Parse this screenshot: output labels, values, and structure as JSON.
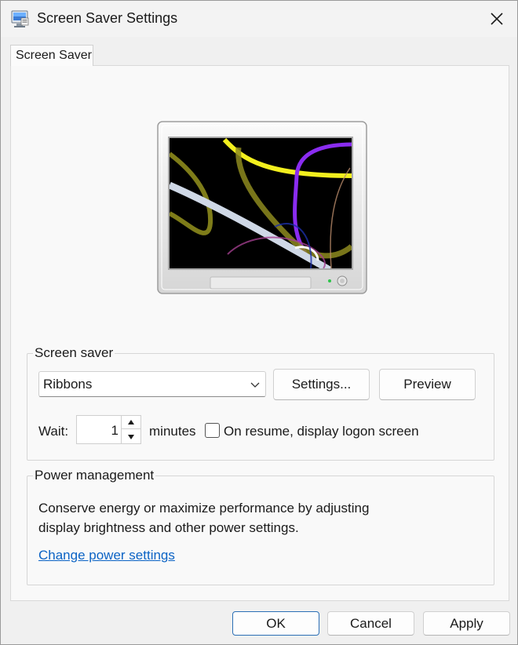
{
  "window": {
    "title": "Screen Saver Settings",
    "icon": "display-settings-icon"
  },
  "tabs": [
    {
      "label": "Screen Saver",
      "selected": true
    }
  ],
  "preview": {
    "screensaver_name": "Ribbons"
  },
  "screen_saver_group": {
    "label": "Screen saver",
    "dropdown_value": "Ribbons",
    "settings_label": "Settings...",
    "preview_label": "Preview",
    "wait_label": "Wait:",
    "wait_value": "1",
    "minutes_label": "minutes",
    "resume_label": "On resume, display logon screen",
    "resume_checked": false
  },
  "power_group": {
    "label": "Power management",
    "description_line1": "Conserve energy or maximize performance by adjusting",
    "description_line2": "display brightness and other power settings.",
    "link_label": "Change power settings"
  },
  "footer": {
    "ok_label": "OK",
    "cancel_label": "Cancel",
    "apply_label": "Apply"
  },
  "colors": {
    "link": "#0b63c5",
    "default_button_border": "#2b6fb5",
    "window_bg": "#f0f0f0"
  }
}
